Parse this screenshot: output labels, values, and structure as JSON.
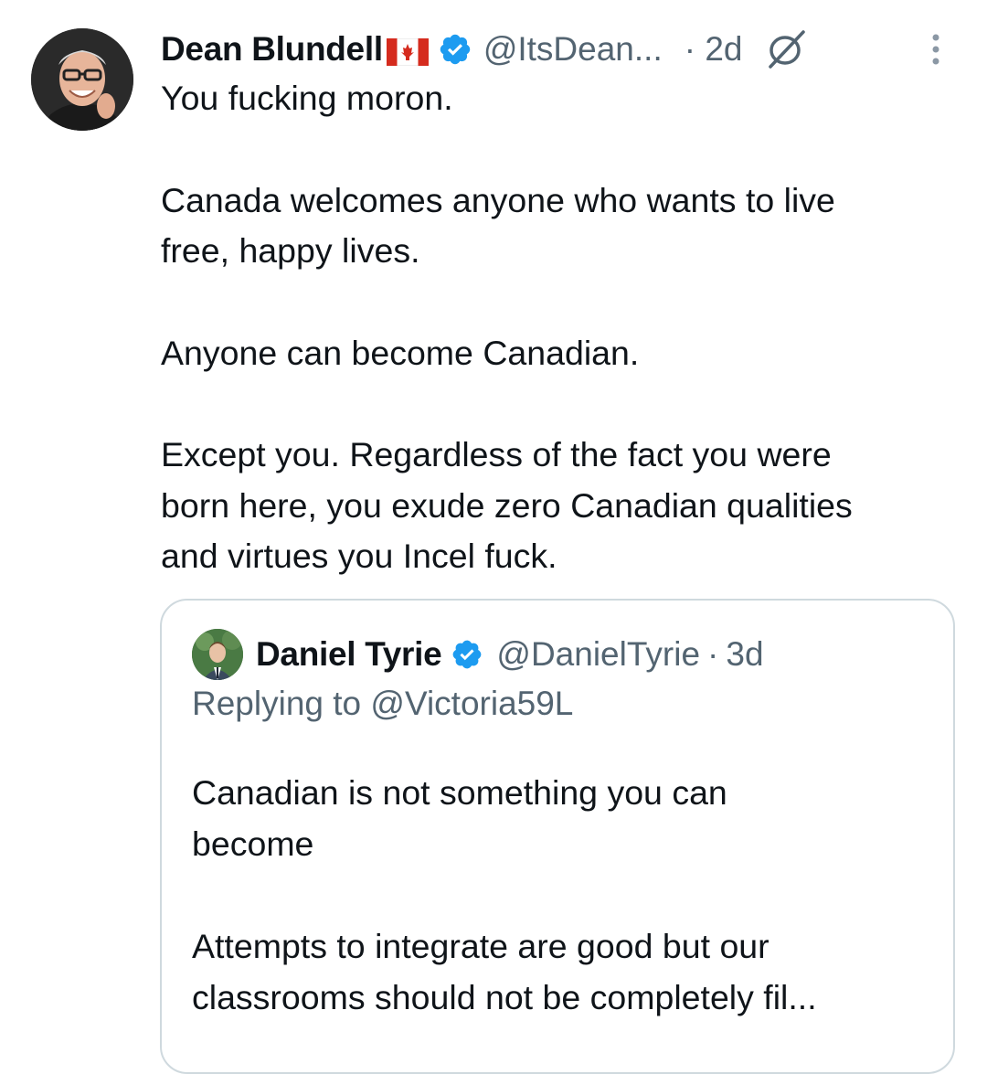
{
  "tweet": {
    "author_name": "Dean Blundell",
    "author_flag": "canada-flag-icon",
    "handle": "@ItsDean...",
    "timestamp": "· 2d",
    "body": [
      "You fucking moron.",
      "Canada welcomes anyone who wants to live\nfree, happy lives.",
      "Anyone can become Canadian.",
      "Except you. Regardless of the fact you were\nborn here, you exude zero Canadian qualities\nand virtues you Incel fuck."
    ]
  },
  "quoted": {
    "author_name": "Daniel Tyrie",
    "handle": "@DanielTyrie",
    "separator": "·",
    "timestamp": "3d",
    "replying_to": "Replying to @Victoria59L",
    "body": [
      "Canadian is not something you can\nbecome",
      "Attempts to integrate are good but our\nclassrooms should not be completely fil..."
    ]
  },
  "colors": {
    "text_primary": "#0f1419",
    "text_secondary": "#536471",
    "verified_blue": "#1d9bf0",
    "border": "#cfd9de"
  }
}
